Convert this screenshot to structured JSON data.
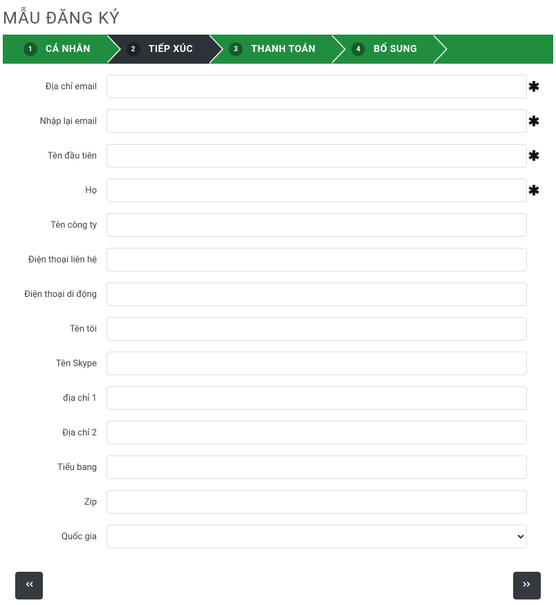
{
  "title": "MẪU ĐĂNG KÝ",
  "steps": [
    {
      "num": "1",
      "label": "CÁ NHÂN"
    },
    {
      "num": "2",
      "label": "TIẾP XÚC"
    },
    {
      "num": "3",
      "label": "THANH TOÁN"
    },
    {
      "num": "4",
      "label": "BỔ SUNG"
    }
  ],
  "fields": {
    "email": {
      "label": "Địa chỉ email",
      "value": "",
      "required": true
    },
    "email_confirm": {
      "label": "Nhập lại email",
      "value": "",
      "required": true
    },
    "first_name": {
      "label": "Tên đầu tiên",
      "value": "",
      "required": true
    },
    "last_name": {
      "label": "Họ",
      "value": "",
      "required": true
    },
    "company": {
      "label": "Tên công ty",
      "value": "",
      "required": false
    },
    "contact_phone": {
      "label": "Điện thoại liên hệ",
      "value": "",
      "required": false
    },
    "mobile_phone": {
      "label": "Điện thoại di động",
      "value": "",
      "required": false
    },
    "my_name": {
      "label": "Tên tôi",
      "value": "",
      "required": false
    },
    "skype": {
      "label": "Tên Skype",
      "value": "",
      "required": false
    },
    "address1": {
      "label": "địa chỉ 1",
      "value": "",
      "required": false
    },
    "address2": {
      "label": "Địa chỉ 2",
      "value": "",
      "required": false
    },
    "state": {
      "label": "Tiểu bang",
      "value": "",
      "required": false
    },
    "zip": {
      "label": "Zip",
      "value": "",
      "required": false
    },
    "country": {
      "label": "Quốc gia",
      "value": "",
      "required": false
    }
  },
  "required_marker": "✱"
}
